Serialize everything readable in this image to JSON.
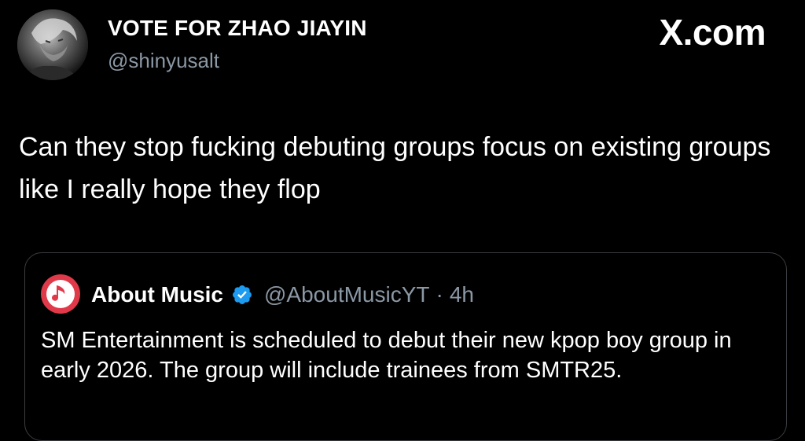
{
  "post": {
    "author": {
      "display_name": "VOTE FOR ZHAO JIAYIN",
      "handle": "@shinyusalt",
      "avatar_icon": "profile-photo"
    },
    "brand": "X.com",
    "text": "Can they stop fucking debuting groups focus on existing groups like I really hope they flop"
  },
  "quote": {
    "author": {
      "display_name": "About Music",
      "handle": "@AboutMusicYT",
      "separator": "·",
      "time": "4h",
      "avatar_icon": "music-note-icon",
      "verified_icon": "verified-badge-icon"
    },
    "text": "SM Entertainment is scheduled to debut their new kpop boy group in early 2026. The group will include trainees from SMTR25."
  },
  "colors": {
    "background": "#000000",
    "primary_text": "#ffffff",
    "secondary_text": "#8b98a5",
    "card_border": "#3a3d41",
    "verified_blue": "#1d9bf0",
    "quote_avatar_red": "#e0394a"
  }
}
